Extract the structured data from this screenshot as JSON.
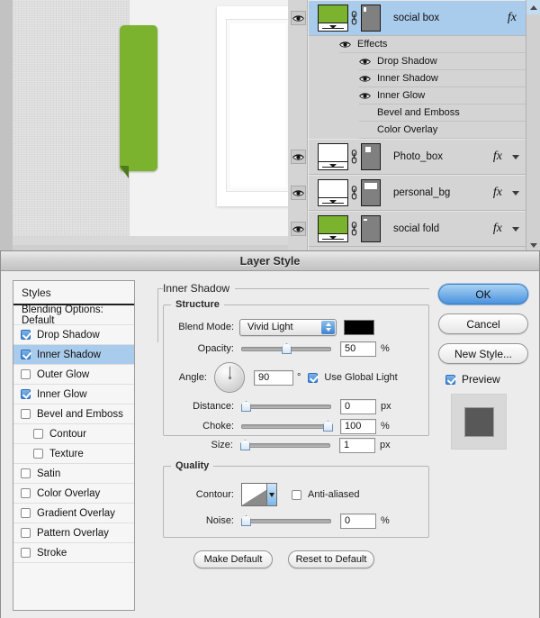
{
  "canvas": {
    "green_tab_color": "#7cb32e",
    "green_fold_color": "#4d7a1b",
    "frame_color": "#ffffff",
    "texture_color": "#e4e4e4"
  },
  "layers_panel": {
    "scroll_up_icon": "triangle-up-icon",
    "scroll_down_icon": "triangle-down-icon",
    "selected_layer": "social box",
    "layers": [
      {
        "name": "social box",
        "visible": true,
        "selected": true,
        "fx": "fx",
        "thumb_color": "#7cb32e",
        "mask_shape": "tiny-bar-top-left",
        "link_icon": "link-icon",
        "eye_icon": "eye-icon"
      },
      {
        "name": "Photo_box",
        "visible": true,
        "selected": false,
        "fx": "fx",
        "thumb_color": "#ffffff",
        "mask_shape": "small-square-top-left",
        "link_icon": "link-icon",
        "eye_icon": "eye-icon"
      },
      {
        "name": "personal_bg",
        "visible": true,
        "selected": false,
        "fx": "fx",
        "thumb_color": "#ffffff",
        "mask_shape": "wide-rect-top",
        "link_icon": "link-icon",
        "eye_icon": "eye-icon"
      },
      {
        "name": "social fold",
        "visible": true,
        "selected": false,
        "fx": "fx",
        "thumb_color": "#7cb32e",
        "mask_shape": "dash-top-left",
        "link_icon": "link-icon",
        "eye_icon": "eye-icon"
      }
    ],
    "effects_group": {
      "label": "Effects",
      "visible": true,
      "items": [
        {
          "label": "Drop Shadow",
          "visible": true
        },
        {
          "label": "Inner Shadow",
          "visible": true
        },
        {
          "label": "Inner Glow",
          "visible": true
        },
        {
          "label": "Bevel and Emboss",
          "visible": false
        },
        {
          "label": "Color Overlay",
          "visible": false
        }
      ]
    }
  },
  "dialog": {
    "title": "Layer Style",
    "styles_header": "Styles",
    "styles": [
      {
        "label": "Blending Options: Default",
        "checkbox": false,
        "has_checkbox": false,
        "selected": false,
        "indent": false
      },
      {
        "label": "Drop Shadow",
        "checkbox": true,
        "has_checkbox": true,
        "selected": false,
        "indent": false
      },
      {
        "label": "Inner Shadow",
        "checkbox": true,
        "has_checkbox": true,
        "selected": true,
        "indent": false
      },
      {
        "label": "Outer Glow",
        "checkbox": false,
        "has_checkbox": true,
        "selected": false,
        "indent": false
      },
      {
        "label": "Inner Glow",
        "checkbox": true,
        "has_checkbox": true,
        "selected": false,
        "indent": false
      },
      {
        "label": "Bevel and Emboss",
        "checkbox": false,
        "has_checkbox": true,
        "selected": false,
        "indent": false
      },
      {
        "label": "Contour",
        "checkbox": false,
        "has_checkbox": true,
        "selected": false,
        "indent": true
      },
      {
        "label": "Texture",
        "checkbox": false,
        "has_checkbox": true,
        "selected": false,
        "indent": true
      },
      {
        "label": "Satin",
        "checkbox": false,
        "has_checkbox": true,
        "selected": false,
        "indent": false
      },
      {
        "label": "Color Overlay",
        "checkbox": false,
        "has_checkbox": true,
        "selected": false,
        "indent": false
      },
      {
        "label": "Gradient Overlay",
        "checkbox": false,
        "has_checkbox": true,
        "selected": false,
        "indent": false
      },
      {
        "label": "Pattern Overlay",
        "checkbox": false,
        "has_checkbox": true,
        "selected": false,
        "indent": false
      },
      {
        "label": "Stroke",
        "checkbox": false,
        "has_checkbox": true,
        "selected": false,
        "indent": false
      }
    ],
    "panel_title": "Inner Shadow",
    "structure": {
      "legend": "Structure",
      "blend_mode_label": "Blend Mode:",
      "blend_mode_value": "Vivid Light",
      "blend_color": "#000000",
      "opacity_label": "Opacity:",
      "opacity_value": "50",
      "opacity_unit": "%",
      "angle_label": "Angle:",
      "angle_value": "90",
      "angle_unit": "°",
      "use_global_light_label": "Use Global Light",
      "use_global_light": true,
      "distance_label": "Distance:",
      "distance_value": "0",
      "distance_unit": "px",
      "choke_label": "Choke:",
      "choke_value": "100",
      "choke_unit": "%",
      "size_label": "Size:",
      "size_value": "1",
      "size_unit": "px"
    },
    "quality": {
      "legend": "Quality",
      "contour_label": "Contour:",
      "anti_aliased_label": "Anti-aliased",
      "anti_aliased": false,
      "noise_label": "Noise:",
      "noise_value": "0",
      "noise_unit": "%"
    },
    "buttons": {
      "ok": "OK",
      "cancel": "Cancel",
      "new_style": "New Style...",
      "preview_label": "Preview",
      "preview_checked": true,
      "make_default": "Make Default",
      "reset_to_default": "Reset to Default"
    }
  }
}
